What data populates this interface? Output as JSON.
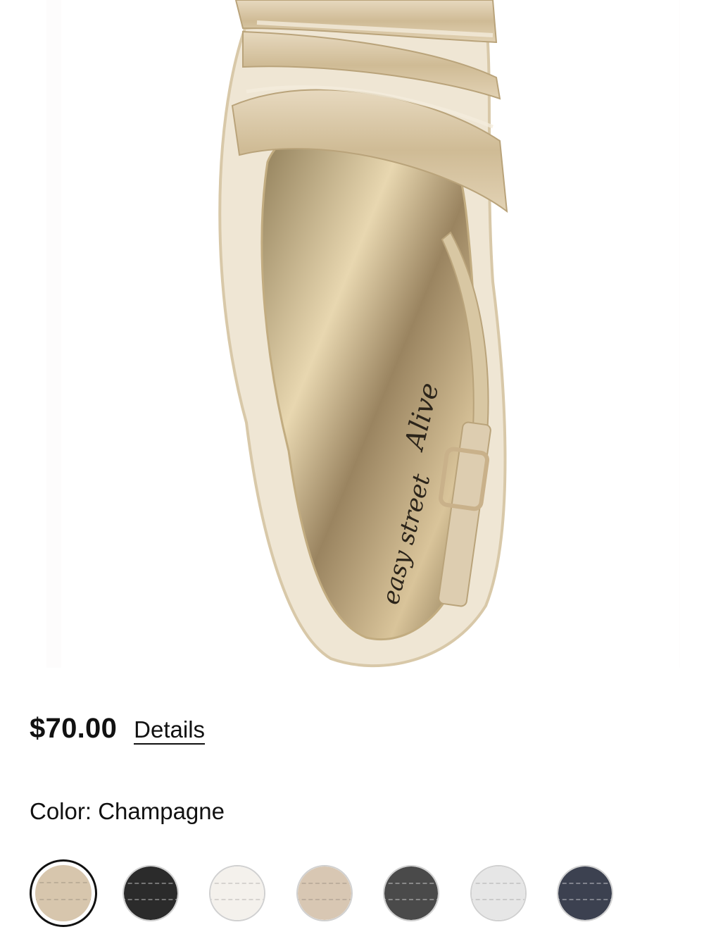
{
  "product": {
    "price": "$70.00",
    "details_label": "Details",
    "color_label": "Color:",
    "color_value": "Champagne",
    "insole_brand": "easy street",
    "insole_sub": "Alive"
  },
  "swatches": [
    {
      "name": "champagne",
      "color": "#d7c6ad",
      "selected": true
    },
    {
      "name": "black",
      "color": "#2b2b2b",
      "selected": false
    },
    {
      "name": "white",
      "color": "#f4f1ec",
      "selected": false
    },
    {
      "name": "nude",
      "color": "#d8c7b3",
      "selected": false
    },
    {
      "name": "dark-grey",
      "color": "#4a4a4a",
      "selected": false
    },
    {
      "name": "silver",
      "color": "#e6e6e6",
      "selected": false
    },
    {
      "name": "navy",
      "color": "#3c4150",
      "selected": false
    }
  ],
  "colors": {
    "gold": "#cdb894",
    "gold_light": "#e9dcc4",
    "insole": "#b8a276"
  }
}
